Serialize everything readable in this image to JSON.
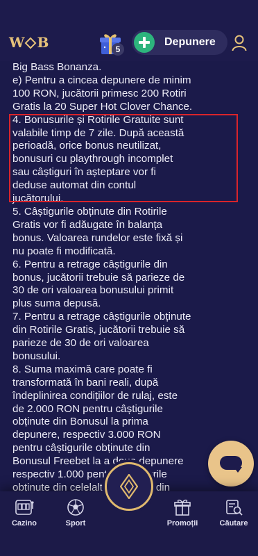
{
  "header": {
    "logo_left": "W",
    "logo_right": "B",
    "gift_count": "5",
    "deposit_label": "Depunere"
  },
  "content": {
    "paragraphs": [
      "Big Bass Bonanza.\ne) Pentru a cincea depunere de minim\n100 RON, jucătorii primesc 200 Rotiri\nGratis la 20 Super Hot Clover Chance.",
      "4. Bonusurile și Rotirile Gratuite sunt\nvalabile timp de 7 zile. După această\nperioadă, orice bonus neutilizat,\nbonusuri cu playthrough incomplet\nsau câștiguri în așteptare vor fi\ndeduse automat din contul\njucătorului.",
      "5. Câștigurile obținute din Rotirile\nGratis vor fi adăugate în balanța\nbonus. Valoarea rundelor este fixă și\nnu poate fi modificată.",
      "6. Pentru a retrage câștigurile din\nbonus, jucătorii trebuie să parieze de\n30 de ori valoarea bonusului primit\nplus suma depusă.",
      "7. Pentru a retrage câștigurile obținute\ndin Rotirile Gratis, jucătorii trebuie să\nparieze de 30 de ori valoarea\nbonusului.",
      "8. Suma maximă care poate fi\ntransformată în bani reali, după\nîndeplinirea condițiilor de rulaj, este\nde 2.000 RON pentru câștigurile\nobținute din Bonusul la prima\ndepunere, respectiv 3.000 RON\npentru câștigurile obținute din\nBonusul Freebet la a doua depunere\nrespectiv 1.000 pentru câștigurile\nobținute din celelalte Bonusuri din\nPachetul de Bun"
    ]
  },
  "bottom_nav": {
    "items": [
      {
        "label": "Cazino",
        "icon": "slot-machine-icon"
      },
      {
        "label": "Sport",
        "icon": "soccer-ball-icon"
      },
      {
        "label": "Promoții",
        "icon": "gift-icon"
      },
      {
        "label": "Căutare",
        "icon": "search-list-icon"
      }
    ],
    "center_icon": "diamond-logo-icon"
  },
  "colors": {
    "background": "#1b1a4a",
    "accent_gold": "#e0b96e",
    "deposit_green": "#2db47d",
    "highlight_red": "#d9242b"
  }
}
